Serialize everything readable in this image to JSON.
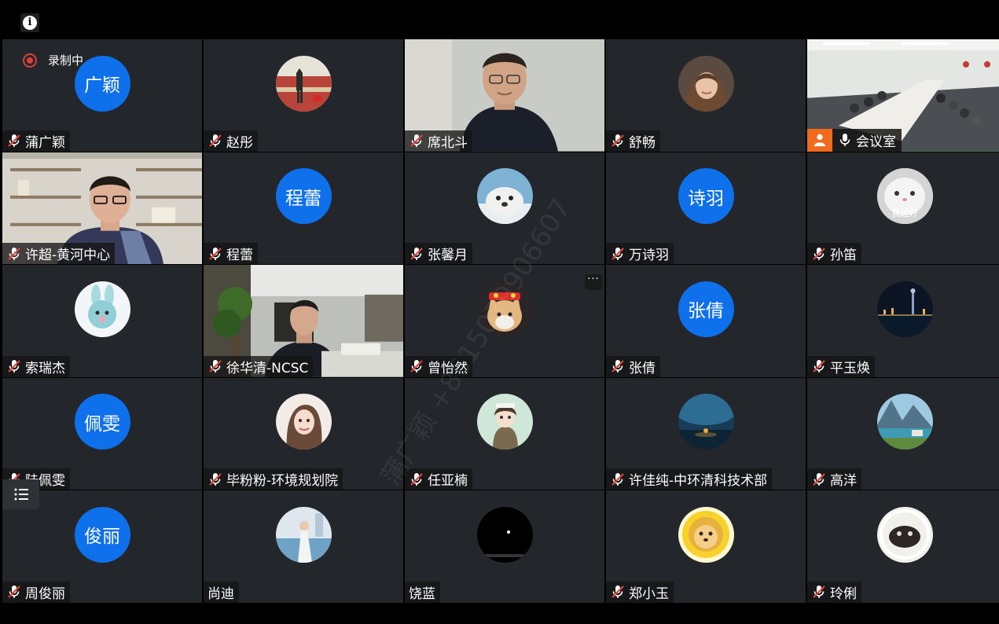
{
  "recording": {
    "label": "录制中"
  },
  "watermark": "蒲广颖 +8615079906607",
  "more_label": "···",
  "tiles": [
    {
      "name": "蒲广颖",
      "avatar_text": "广颖"
    },
    {
      "name": "赵彤"
    },
    {
      "name": "席北斗"
    },
    {
      "name": "舒畅"
    },
    {
      "name": "会议室"
    },
    {
      "name": "许超-黄河中心"
    },
    {
      "name": "程蕾",
      "avatar_text": "程蕾"
    },
    {
      "name": "张馨月"
    },
    {
      "name": "万诗羽",
      "avatar_text": "诗羽"
    },
    {
      "name": "孙笛",
      "avatar_caption": "我还好"
    },
    {
      "name": "索瑞杰"
    },
    {
      "name": "徐华清-NCSC"
    },
    {
      "name": "曾怡然"
    },
    {
      "name": "张倩",
      "avatar_text": "张倩"
    },
    {
      "name": "平玉焕"
    },
    {
      "name": "陆佩雯",
      "avatar_text": "佩雯"
    },
    {
      "name": "毕粉粉-环境规划院"
    },
    {
      "name": "任亚楠"
    },
    {
      "name": "许佳纯-中环清科技术部"
    },
    {
      "name": "高洋"
    },
    {
      "name": "周俊丽",
      "avatar_text": "俊丽"
    },
    {
      "name": "尚迪"
    },
    {
      "name": "饶蓝"
    },
    {
      "name": "郑小玉"
    },
    {
      "name": "玲俐"
    }
  ],
  "colors": {
    "avatar_blue": "#0e71eb",
    "tile_bg": "#23262b",
    "mute_red": "#e0453d",
    "room_orange": "#f26b1d",
    "active_border": "#1f9a48"
  }
}
